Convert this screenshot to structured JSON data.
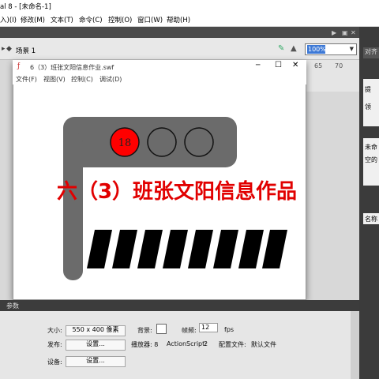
{
  "app": {
    "title": "al 8 - [未命名-1]"
  },
  "menu": [
    "入)(I)",
    "修改(M)",
    "文本(T)",
    "命令(C)",
    "控制(O)",
    "窗口(W)",
    "帮助(H)"
  ],
  "scene": {
    "label": "场景 1",
    "zoom": "100%"
  },
  "timeline_numbers": [
    "65",
    "70"
  ],
  "right_panel": {
    "tab1": "对齐",
    "t1": "未命",
    "t2": "空的",
    "t3": "名称",
    "t4": "提",
    "t5": "领"
  },
  "swf_window": {
    "title": "6（3）班张文阳信息作业.swf",
    "menu": [
      "文件(F)",
      "视图(V)",
      "控制(C)",
      "调试(D)"
    ],
    "minimize": "─",
    "maximize": "☐",
    "close": "✕"
  },
  "artwork": {
    "light_number": "18",
    "headline": "六（3）班张文阳信息作品",
    "colors": {
      "red_light": "#ff0000",
      "pole": "#6b6b6b",
      "headline": "#e10000",
      "stripes": "#000000"
    },
    "stripe_count": 8
  },
  "properties": {
    "header": "参数",
    "size_label": "大小:",
    "size_value": "550 x 400 像素",
    "bg_label": "背景:",
    "fps_label": "帧频:",
    "fps_value": "12",
    "fps_unit": "fps",
    "publish_label": "发布:",
    "settings_button": "设置...",
    "player_label": "播放器: 8",
    "as_label": "ActionScript:",
    "as_value": "2",
    "profile_label": "配置文件:",
    "profile_value": "默认文件",
    "device_label": "设备:",
    "device_button": "设置..."
  }
}
